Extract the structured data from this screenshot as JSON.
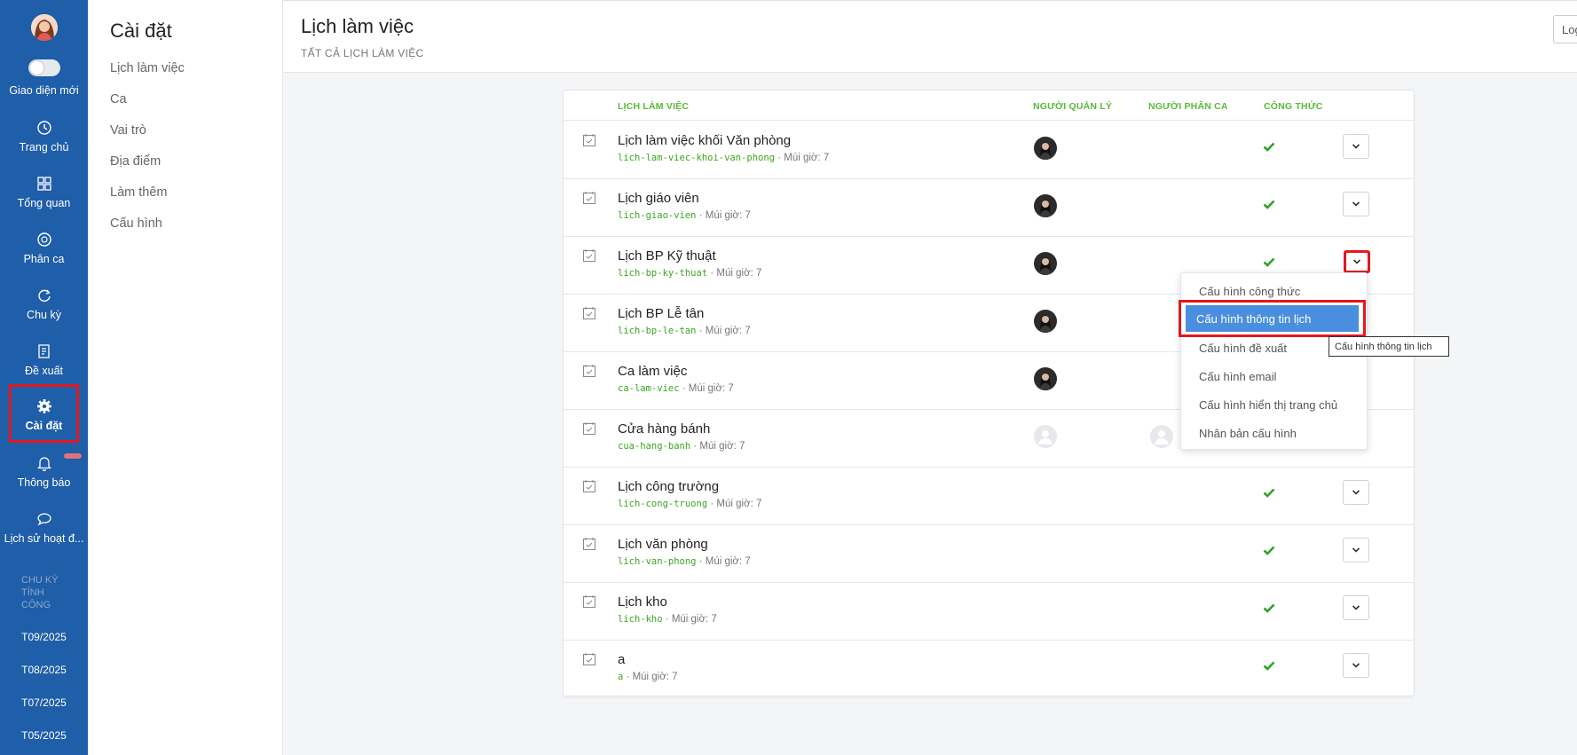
{
  "nav": {
    "toggle_label": "Giao diện mới",
    "items": [
      {
        "label": "Trang chủ",
        "icon": "clock-icon"
      },
      {
        "label": "Tổng quan",
        "icon": "grid-icon"
      },
      {
        "label": "Phân ca",
        "icon": "schedule-icon"
      },
      {
        "label": "Chu kỳ",
        "icon": "cycle-icon"
      },
      {
        "label": "Đề xuất",
        "icon": "proposal-icon"
      },
      {
        "label": "Cài đặt",
        "icon": "gear-icon"
      },
      {
        "label": "Thông báo",
        "icon": "bell-icon"
      },
      {
        "label": "Lịch sử hoạt đ...",
        "icon": "chat-icon"
      }
    ],
    "cycle_heading": "CHU KỲ TÍNH CÔNG",
    "cycles": [
      "T09/2025",
      "T08/2025",
      "T07/2025",
      "T05/2025"
    ]
  },
  "settings": {
    "title": "Cài đặt",
    "items": [
      "Lịch làm việc",
      "Ca",
      "Vai trò",
      "Địa điểm",
      "Làm thêm",
      "Cấu hình"
    ]
  },
  "header": {
    "title": "Lịch làm việc",
    "subtitle": "TẤT CẢ LỊCH LÀM VIỆC",
    "logout_label": "Logout"
  },
  "table": {
    "columns": [
      "LỊCH LÀM VIỆC",
      "NGƯỜI QUẢN LÝ",
      "NGƯỜI PHÂN CA",
      "CÔNG THỨC"
    ],
    "tz_label": "Múi giờ: 7",
    "rows": [
      {
        "name": "Lịch làm việc khối Văn phòng",
        "slug": "lich-lam-viec-khoi-van-phong",
        "manager": "photo",
        "shift": "",
        "formula": true
      },
      {
        "name": "Lịch giáo viên",
        "slug": "lich-giao-vien",
        "manager": "photo",
        "shift": "",
        "formula": true
      },
      {
        "name": "Lịch BP Kỹ thuật",
        "slug": "lich-bp-ky-thuat",
        "manager": "photo",
        "shift": "",
        "formula": true
      },
      {
        "name": "Lịch BP Lễ tân",
        "slug": "lich-bp-le-tan",
        "manager": "photo",
        "shift": "",
        "formula": false
      },
      {
        "name": "Ca làm việc",
        "slug": "ca-lam-viec",
        "manager": "photo",
        "shift": "",
        "formula": false
      },
      {
        "name": "Cửa hàng bánh",
        "slug": "cua-hang-banh",
        "manager": "placeholder",
        "shift": "placeholder",
        "formula": false
      },
      {
        "name": "Lịch công trường",
        "slug": "lich-cong-truong",
        "manager": "",
        "shift": "",
        "formula": true
      },
      {
        "name": "Lịch văn phòng",
        "slug": "lich-van-phong",
        "manager": "",
        "shift": "",
        "formula": true
      },
      {
        "name": "Lịch kho",
        "slug": "lich-kho",
        "manager": "",
        "shift": "",
        "formula": true
      },
      {
        "name": "a",
        "slug": "a",
        "manager": "",
        "shift": "",
        "formula": true
      }
    ]
  },
  "menu": {
    "items": [
      "Cấu hình công thức",
      "Cấu hình thông tin lịch",
      "Cấu hình đề xuất",
      "Cấu hình email",
      "Cấu hình hiển thị trang chủ",
      "Nhân bản cấu hình"
    ],
    "tooltip": "Cấu hình thông tin lịch"
  },
  "colors": {
    "nav_bg": "#1f5ea8",
    "accent_green": "#3aa61f",
    "highlight_red": "#e5171f",
    "menu_active": "#4a8fdf"
  }
}
